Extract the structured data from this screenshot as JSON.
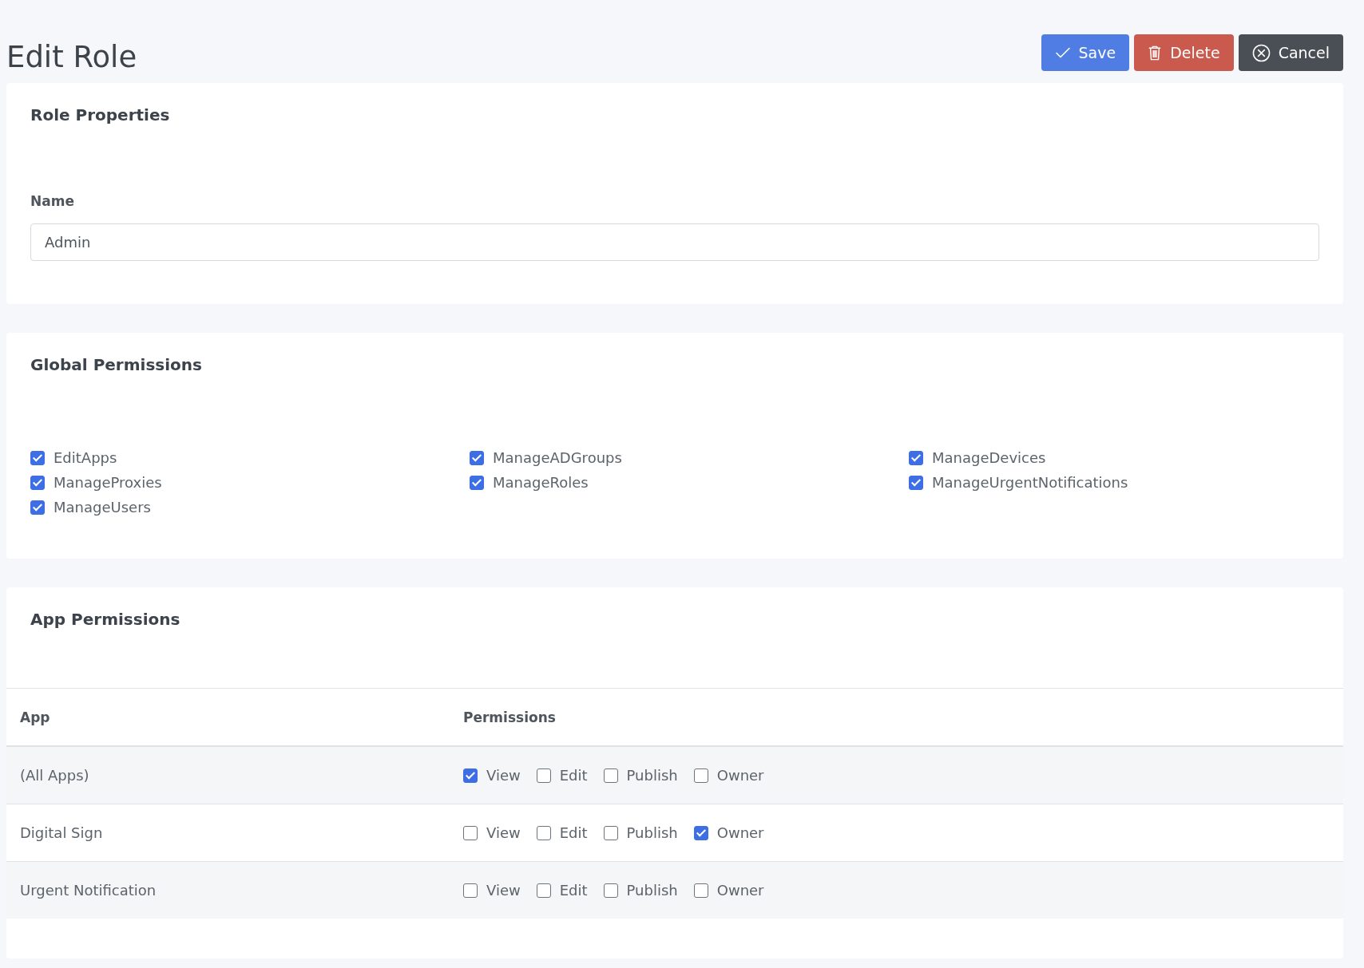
{
  "header": {
    "title": "Edit Role",
    "buttons": [
      {
        "kind": "save",
        "label": "Save"
      },
      {
        "kind": "delete",
        "label": "Delete"
      },
      {
        "kind": "cancel",
        "label": "Cancel"
      }
    ]
  },
  "role_properties": {
    "title": "Role Properties",
    "name_label": "Name",
    "name_value": "Admin"
  },
  "global_permissions": {
    "title": "Global Permissions",
    "items": [
      {
        "label": "EditApps",
        "checked": true
      },
      {
        "label": "ManageADGroups",
        "checked": true
      },
      {
        "label": "ManageDevices",
        "checked": true
      },
      {
        "label": "ManageProxies",
        "checked": true
      },
      {
        "label": "ManageRoles",
        "checked": true
      },
      {
        "label": "ManageUrgentNotifications",
        "checked": true
      },
      {
        "label": "ManageUsers",
        "checked": true
      }
    ]
  },
  "app_permissions": {
    "title": "App Permissions",
    "columns": [
      "App",
      "Permissions"
    ],
    "rows": [
      {
        "app": "(All Apps)",
        "permissions": [
          {
            "label": "View",
            "checked": true
          },
          {
            "label": "Edit",
            "checked": false
          },
          {
            "label": "Publish",
            "checked": false
          },
          {
            "label": "Owner",
            "checked": false
          }
        ]
      },
      {
        "app": "Digital Sign",
        "permissions": [
          {
            "label": "View",
            "checked": false
          },
          {
            "label": "Edit",
            "checked": false
          },
          {
            "label": "Publish",
            "checked": false
          },
          {
            "label": "Owner",
            "checked": true
          }
        ]
      },
      {
        "app": "Urgent Notification",
        "permissions": [
          {
            "label": "View",
            "checked": false
          },
          {
            "label": "Edit",
            "checked": false
          },
          {
            "label": "Publish",
            "checked": false
          },
          {
            "label": "Owner",
            "checked": false
          }
        ]
      }
    ]
  }
}
